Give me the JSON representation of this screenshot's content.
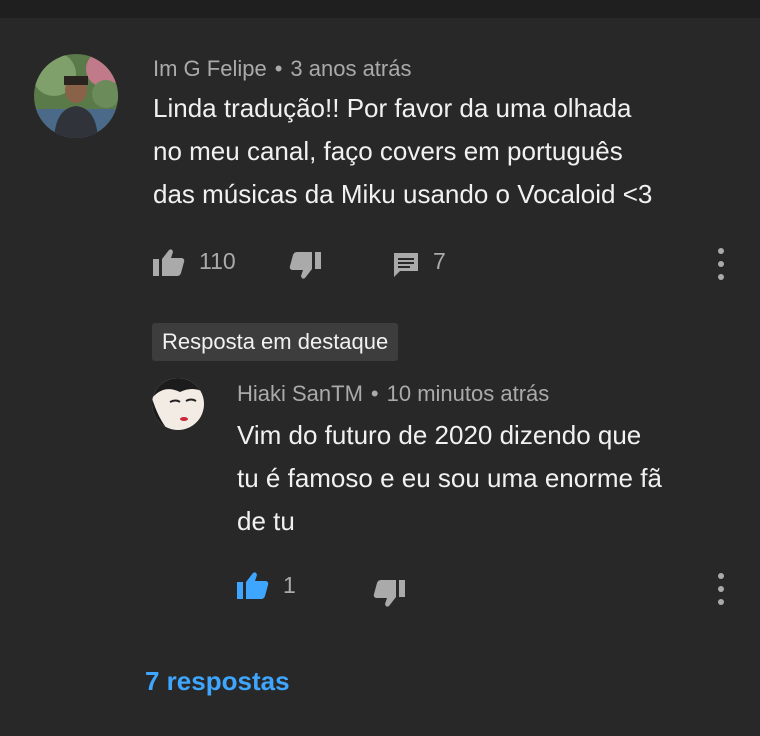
{
  "comment": {
    "author": "Im G Felipe",
    "separator": "•",
    "time": "3 anos atrás",
    "text_lines": [
      "Linda tradução!! Por favor da uma olhada",
      "no meu canal, faço covers em português",
      "das músicas da Miku usando o Vocaloid <3"
    ],
    "likes": "110",
    "reply_count": "7",
    "avatar_icon": "user-photo-avatar",
    "like_icon": "thumb-up-icon",
    "dislike_icon": "thumb-down-icon",
    "reply_icon": "comment-icon",
    "more_icon": "more-vertical-icon"
  },
  "highlight_badge": "Resposta em destaque",
  "reply": {
    "author": "Hiaki SanTM",
    "separator": "•",
    "time": "10 minutos atrás",
    "text_lines": [
      "Vim do futuro de 2020 dizendo que",
      "tu é famoso e eu sou uma enorme fã",
      "de tu"
    ],
    "likes": "1",
    "liked": true
  },
  "view_replies": "7 respostas",
  "colors": {
    "background": "#282828",
    "text": "#f1f1f1",
    "secondary": "#aaaaaa",
    "link": "#3ea6ff",
    "liked": "#3ea6ff"
  }
}
